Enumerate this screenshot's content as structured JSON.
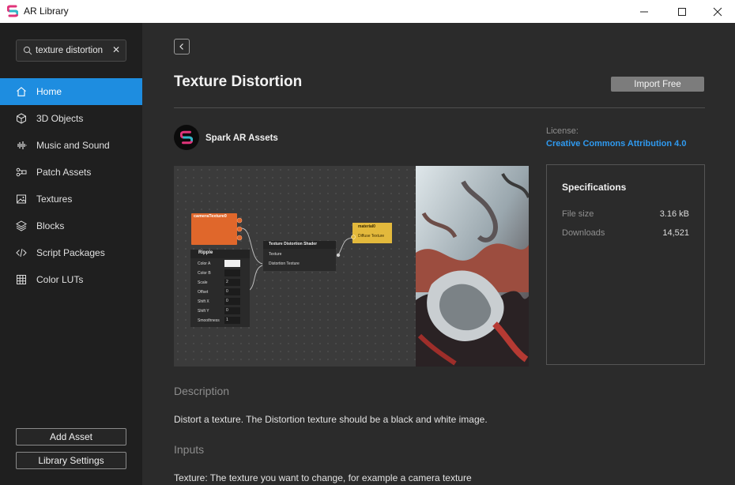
{
  "window": {
    "title": "AR Library",
    "minimize_glyph": "—",
    "maximize_glyph": "☐",
    "close_glyph": "✕"
  },
  "sidebar": {
    "search": {
      "value": "texture distortion",
      "placeholder": "Search"
    },
    "items": [
      {
        "label": "Home",
        "icon": "home-icon",
        "active": true
      },
      {
        "label": "3D Objects",
        "icon": "cube-icon"
      },
      {
        "label": "Music and Sound",
        "icon": "waveform-icon"
      },
      {
        "label": "Patch Assets",
        "icon": "patch-icon"
      },
      {
        "label": "Textures",
        "icon": "image-icon"
      },
      {
        "label": "Blocks",
        "icon": "blocks-icon"
      },
      {
        "label": "Script Packages",
        "icon": "code-icon"
      },
      {
        "label": "Color LUTs",
        "icon": "grid-icon"
      }
    ],
    "add_asset_label": "Add Asset",
    "library_settings_label": "Library Settings"
  },
  "main": {
    "title": "Texture Distortion",
    "import_label": "Import Free",
    "author": "Spark AR Assets",
    "license_label": "License:",
    "license_value": "Creative Commons Attribution 4.0",
    "specs": {
      "title": "Specifications",
      "file_size_label": "File size",
      "file_size_value": "3.16 kB",
      "downloads_label": "Downloads",
      "downloads_value": "14,521"
    },
    "description_heading": "Description",
    "description_text": "Distort a texture. The Distortion texture should be a black and white image.",
    "inputs_heading": "Inputs",
    "inputs_text": "Texture: The texture you want to change, for example a camera texture"
  },
  "preview": {
    "camera_node": "cameraTexture0",
    "ripple_node": "Ripple",
    "ripple_params": [
      {
        "name": "Color A",
        "value": ""
      },
      {
        "name": "Color B",
        "value": ""
      },
      {
        "name": "Scale",
        "value": "2"
      },
      {
        "name": "Offset",
        "value": "0"
      },
      {
        "name": "Shift X",
        "value": "0"
      },
      {
        "name": "Shift Y",
        "value": "0"
      },
      {
        "name": "Smoothness",
        "value": "1"
      }
    ],
    "shader_node": "Texture Distortion Shader",
    "shader_inputs": [
      "Texture",
      "Distortion Texture"
    ],
    "material_node": "material0",
    "material_input": "Diffuse Texture"
  },
  "colors": {
    "accent": "#1e8de0",
    "link": "#2f9af0",
    "camera_node": "#e0672b",
    "material_node": "#e3b93c"
  }
}
